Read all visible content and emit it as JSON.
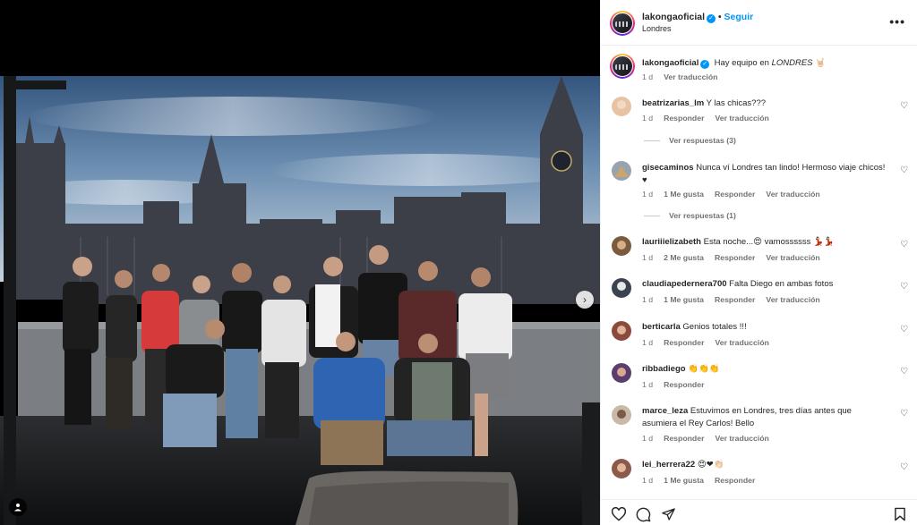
{
  "post": {
    "username": "lakongaoficial",
    "follow_label": "Seguir",
    "location": "Londres",
    "more_label": "•••",
    "caption_prefix": "Hay equipo en ",
    "caption_place": "LONDRES",
    "caption_suffix": " 🤘🏻",
    "caption_time": "1 d",
    "caption_translate": "Ver traducción"
  },
  "comments": [
    {
      "user": "beatrizarias_lm",
      "text": "Y las chicas???",
      "time": "1 d",
      "likes": "",
      "reply": "Responder",
      "translate": "Ver traducción",
      "replies": "Ver respuestas (3)",
      "avatar_color": "#e7c3a3"
    },
    {
      "user": "gisecaminos",
      "text": "Nunca ví Londres tan lindo! Hermoso viaje chicos! ♥",
      "time": "1 d",
      "likes": "1 Me gusta",
      "reply": "Responder",
      "translate": "Ver traducción",
      "replies": "Ver respuestas (1)",
      "avatar_color": "#9aa3ad"
    },
    {
      "user": "lauriiielizabeth",
      "text": "Esta noche...😍 vamossssss 💃🏻💃🏻",
      "time": "1 d",
      "likes": "2 Me gusta",
      "reply": "Responder",
      "translate": "Ver traducción",
      "replies": "",
      "avatar_color": "#7a5b3e"
    },
    {
      "user": "claudiapedernera700",
      "text": "Falta Diego en ambas fotos",
      "time": "1 d",
      "likes": "1 Me gusta",
      "reply": "Responder",
      "translate": "Ver traducción",
      "replies": "",
      "avatar_color": "#3b4250"
    },
    {
      "user": "berticarla",
      "text": "Genios totales !!!",
      "time": "1 d",
      "likes": "",
      "reply": "Responder",
      "translate": "Ver traducción",
      "replies": "",
      "avatar_color": "#8a4b3c"
    },
    {
      "user": "ribbadiego",
      "text": "👏👏👏",
      "time": "1 d",
      "likes": "",
      "reply": "Responder",
      "translate": "",
      "replies": "",
      "avatar_color": "#5b3d6e"
    },
    {
      "user": "marce_leza",
      "text": "Estuvimos en Londres, tres días antes que asumiera el Rey Carlos! Bello",
      "time": "1 d",
      "likes": "",
      "reply": "Responder",
      "translate": "Ver traducción",
      "replies": "",
      "avatar_color": "#c9b9a8"
    },
    {
      "user": "lei_herrera22",
      "text": "😍❤👏🏻",
      "time": "1 d",
      "likes": "1 Me gusta",
      "reply": "Responder",
      "translate": "",
      "replies": "",
      "avatar_color": "#8b5a4a"
    }
  ],
  "icons": {
    "heart": "heart-icon",
    "comment": "comment-icon",
    "share": "paper-plane-icon",
    "save": "bookmark-icon",
    "verified": "verified-badge-icon",
    "user_tag": "user-tag-icon",
    "carousel_next": "chevron-right-icon"
  },
  "colors": {
    "accent": "#0095f6",
    "text": "#262626",
    "secondary": "#737373"
  }
}
